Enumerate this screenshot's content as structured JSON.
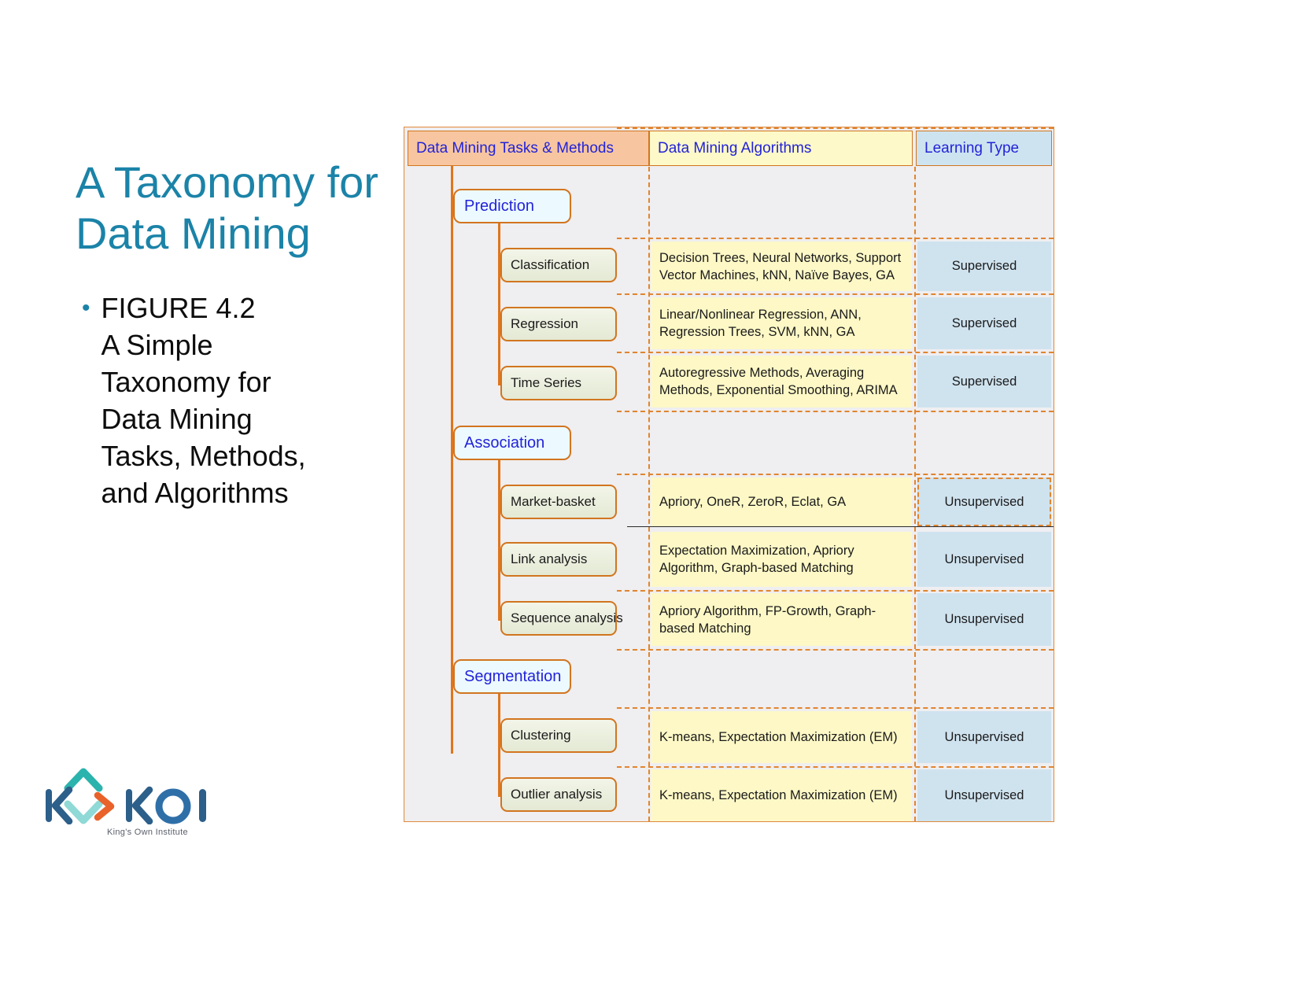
{
  "slide": {
    "title": "A Taxonomy for\nData Mining",
    "bullet_marker": "•",
    "bullet_text": "FIGURE 4.2\nA Simple\nTaxonomy for\nData Mining\nTasks, Methods,\nand Algorithms",
    "title_color": "#1b83a8"
  },
  "logo": {
    "name": "KOI",
    "tagline": "King's Own Institute",
    "colors": {
      "dark_blue": "#2c5f8a",
      "blue": "#2f6fa8",
      "teal": "#2bb3ad",
      "orange": "#e8622a"
    }
  },
  "figure": {
    "headers": {
      "tasks": "Data Mining Tasks & Methods",
      "algorithms": "Data Mining Algorithms",
      "learning_type": "Learning Type"
    },
    "header_colors": {
      "tasks_bg": "#f7c6a0",
      "algorithms_bg": "#fdf9c8",
      "learning_type_bg": "#cde4f0",
      "header_text": "#2323d8",
      "border": "#d2751f"
    },
    "categories": [
      {
        "label": "Prediction"
      },
      {
        "label": "Association"
      },
      {
        "label": "Segmentation"
      }
    ],
    "rows": [
      {
        "method": "Classification",
        "algorithms": "Decision Trees, Neural Networks, Support\nVector Machines, kNN, Naïve Bayes, GA",
        "learning_type": "Supervised"
      },
      {
        "method": "Regression",
        "algorithms": "Linear/Nonlinear Regression, ANN,\nRegression Trees, SVM, kNN, GA",
        "learning_type": "Supervised"
      },
      {
        "method": "Time Series",
        "algorithms": "Autoregressive Methods, Averaging\nMethods, Exponential Smoothing, ARIMA",
        "learning_type": "Supervised"
      },
      {
        "method": "Market-basket",
        "algorithms": "Apriory, OneR, ZeroR, Eclat, GA",
        "learning_type": "Unsupervised"
      },
      {
        "method": "Link analysis",
        "algorithms": "Expectation Maximization, Apriory\nAlgorithm, Graph-based Matching",
        "learning_type": "Unsupervised"
      },
      {
        "method": "Sequence analysis",
        "algorithms": "Apriory Algorithm, FP-Growth, Graph-\nbased Matching",
        "learning_type": "Unsupervised"
      },
      {
        "method": "Clustering",
        "algorithms": "K-means, Expectation Maximization (EM)",
        "learning_type": "Unsupervised"
      },
      {
        "method": "Outlier analysis",
        "algorithms": "K-means, Expectation Maximization (EM)",
        "learning_type": "Unsupervised"
      }
    ]
  }
}
